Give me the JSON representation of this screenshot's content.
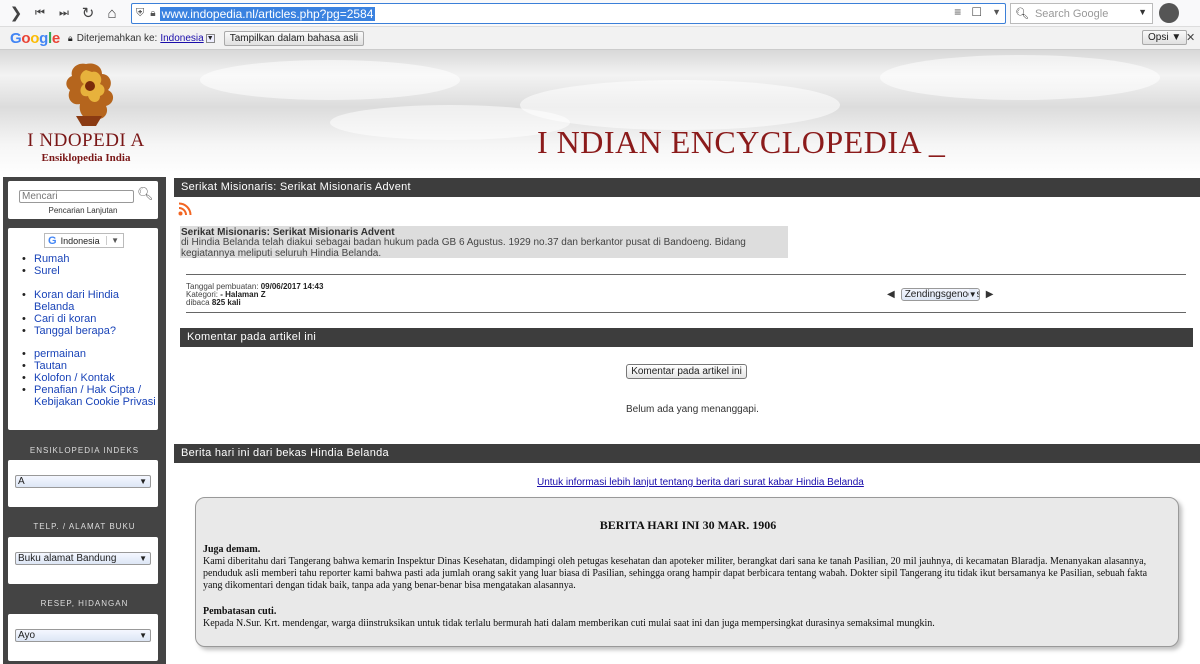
{
  "browser": {
    "url": "www.indopedia.nl/articles.php?pg=2584",
    "search_placeholder": "Search Google"
  },
  "translate_bar": {
    "label": "Diterjemahkan ke:",
    "language": "Indonesia",
    "show_original": "Tampilkan dalam bahasa asli",
    "options": "Opsi ▼"
  },
  "header": {
    "logo_title": "I NDOPEDI A",
    "logo_subtitle": "Ensiklopedia India",
    "site_title": "I NDIAN ENCYCLOPEDIA _"
  },
  "sidebar": {
    "search_placeholder": "Mencari",
    "advanced_search": "Pencarian Lanjutan",
    "language": "Indonesia",
    "menu1": [
      "Rumah",
      "Surel"
    ],
    "menu2": [
      "Koran dari Hindia Belanda",
      "Cari di koran",
      "Tanggal berapa?"
    ],
    "menu3": [
      "permainan",
      "Tautan",
      "Kolofon / Kontak",
      "Penafian / Hak Cipta / Kebijakan Cookie Privasi"
    ],
    "index_heading": "ENSIKLOPEDIA INDEKS",
    "index_value": "A",
    "phone_heading": "TELP. / ALAMAT BUKU",
    "phone_value": "Buku alamat Bandung",
    "recipe_heading": "RESEP, HIDANGAN",
    "recipe_value": "Ayo"
  },
  "article": {
    "bar_title": "Serikat Misionaris: Serikat Misionaris Advent",
    "title": "Serikat Misionaris: Serikat Misionaris Advent",
    "body": "di Hindia Belanda telah diakui sebagai badan hukum pada GB 6 Agustus. 1929 no.37 dan berkantor pusat di Bandoeng. Bidang kegiatannya meliputi seluruh Hindia Belanda.",
    "created_label": "Tanggal pembuatan:",
    "created_value": "09/06/2017 14:43",
    "category_label": "Kategori:",
    "category_value": "- Halaman Z",
    "read_label": "dibaca",
    "read_value": "825 kali",
    "pager_value": "Zendingsgenootschap"
  },
  "comments": {
    "bar_title": "Komentar pada artikel ini",
    "button": "Komentar pada artikel ini",
    "empty": "Belum ada yang menanggapi."
  },
  "news": {
    "bar_title": "Berita hari ini dari bekas Hindia Belanda",
    "link": "Untuk informasi lebih lanjut tentang berita dari surat kabar Hindia Belanda",
    "headline": "BERITA HARI INI 30 MAR. 1906",
    "sub1": "Juga demam.",
    "p1": "Kami diberitahu dari Tangerang bahwa kemarin Inspektur Dinas Kesehatan, didampingi oleh petugas kesehatan dan apoteker militer, berangkat dari sana ke tanah Pasilian, 20 mil jauhnya, di kecamatan Blaradja. Menanyakan alasannya, penduduk asli memberi tahu reporter kami bahwa pasti ada jumlah orang sakit yang luar biasa di Pasilian, sehingga orang hampir dapat berbicara tentang wabah. Dokter sipil Tangerang itu tidak ikut bersamanya ke Pasilian, sebuah fakta yang dikomentari dengan tidak baik, tanpa ada yang benar-benar bisa mengatakan alasannya.",
    "sub2": "Pembatasan cuti.",
    "p2": "Kepada N.Sur. Krt. mendengar, warga diinstruksikan untuk tidak terlalu bermurah hati dalam memberikan cuti mulai saat ini dan juga mempersingkat durasinya semaksimal mungkin."
  }
}
